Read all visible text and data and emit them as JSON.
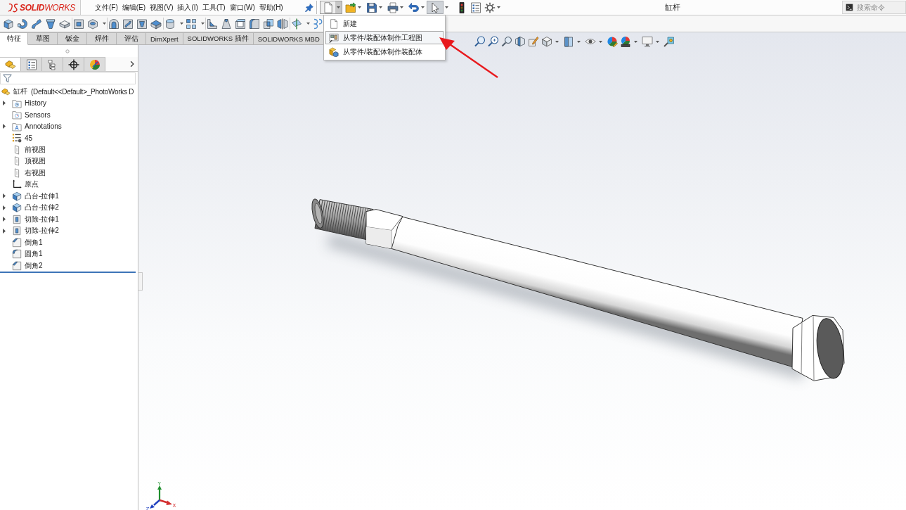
{
  "logo": {
    "text": "**SOLID**WORKS"
  },
  "menu": [
    "文件(F)",
    "编辑(E)",
    "视图(V)",
    "插入(I)",
    "工具(T)",
    "窗口(W)",
    "帮助(H)"
  ],
  "quick_toolbar": {
    "new_document": {
      "expanded": true
    },
    "select": {
      "selected": true
    }
  },
  "new_document_menu": {
    "items": [
      {
        "label": "新建",
        "kind": "document",
        "selected": false
      },
      {
        "label": "从零件/装配体制作工程图",
        "kind": "drawing",
        "selected": true
      },
      {
        "label": "从零件/装配体制作装配体",
        "kind": "assembly",
        "selected": false
      }
    ]
  },
  "document_title": "缸杆",
  "search": {
    "placeholder": "搜索命令"
  },
  "command_tabs": [
    {
      "label": "特征",
      "selected": true
    },
    {
      "label": "草图",
      "selected": false
    },
    {
      "label": "钣金",
      "selected": false
    },
    {
      "label": "焊件",
      "selected": false
    },
    {
      "label": "评估",
      "selected": false
    },
    {
      "label": "DimXpert",
      "selected": false
    },
    {
      "label": "SOLIDWORKS 插件",
      "selected": false
    },
    {
      "label": "SOLIDWORKS MBD",
      "selected": false
    }
  ],
  "panel_tabs": [
    {
      "kind": "features",
      "selected": true
    },
    {
      "kind": "properties",
      "selected": false
    },
    {
      "kind": "configurations",
      "selected": false
    },
    {
      "kind": "dimxpert",
      "selected": false
    },
    {
      "kind": "display",
      "selected": false
    }
  ],
  "feature_tree": {
    "root": {
      "name": "缸杆",
      "configuration": "(Default<<Default>_PhotoWorks D"
    },
    "items": [
      {
        "label": "History",
        "kind": "history",
        "expandable": true
      },
      {
        "label": "Sensors",
        "kind": "sensors",
        "expandable": false
      },
      {
        "label": "Annotations",
        "kind": "annotations",
        "expandable": true
      },
      {
        "label": "45",
        "kind": "equations",
        "expandable": false
      },
      {
        "label": "前视图",
        "kind": "plane",
        "expandable": false
      },
      {
        "label": "顶视图",
        "kind": "plane",
        "expandable": false
      },
      {
        "label": "右视图",
        "kind": "plane",
        "expandable": false
      },
      {
        "label": "原点",
        "kind": "origin",
        "expandable": false
      },
      {
        "label": "凸台-拉伸1",
        "kind": "boss",
        "expandable": true
      },
      {
        "label": "凸台-拉伸2",
        "kind": "boss",
        "expandable": true
      },
      {
        "label": "切除-拉伸1",
        "kind": "cut",
        "expandable": true
      },
      {
        "label": "切除-拉伸2",
        "kind": "cut",
        "expandable": true
      },
      {
        "label": "倒角1",
        "kind": "chamfer",
        "expandable": false
      },
      {
        "label": "圆角1",
        "kind": "fillet",
        "expandable": false
      },
      {
        "label": "倒角2",
        "kind": "chamfer",
        "expandable": false
      }
    ]
  },
  "triad": {
    "x_label": "X",
    "y_label": "Y",
    "z_label": "Z"
  }
}
